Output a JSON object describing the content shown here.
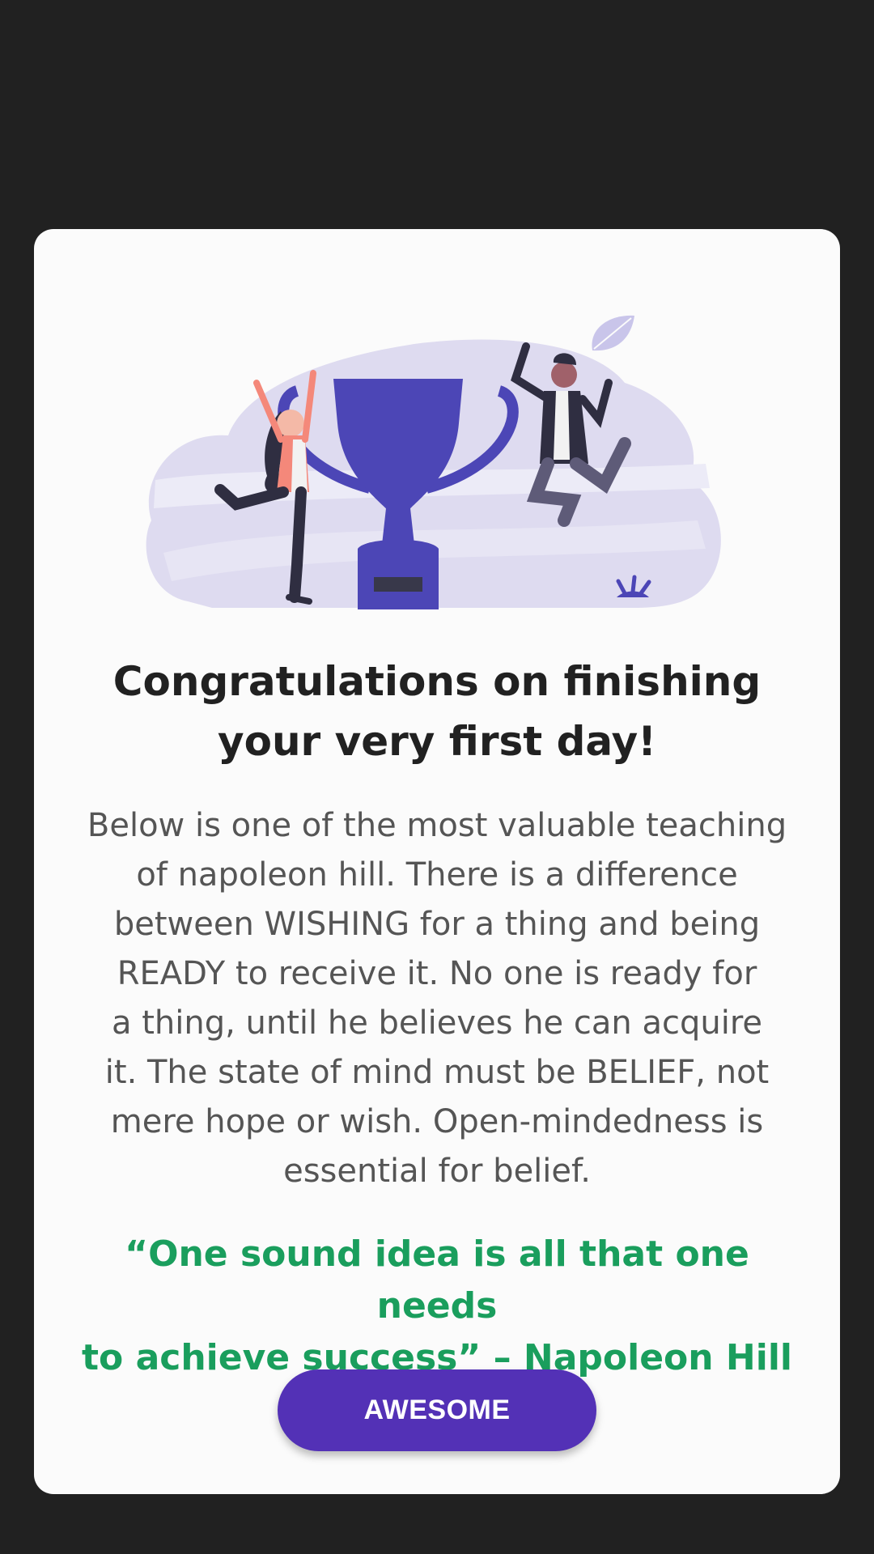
{
  "dialog": {
    "title": "Congratulations on finishing\nyour very first day!",
    "body": "Below is one of the most valuable teaching\nof napoleon hill.  There is a difference\nbetween WISHING for a thing and being\nREADY to receive it. No one is ready for\na thing, until he believes he can acquire\nit.  The state of mind must be BELIEF, not\nmere hope or wish. Open-mindedness is\nessential for belief.",
    "quote": "“One sound idea is all that one needs\nto achieve success” – Napoleon Hill",
    "button_label": "AWESOME"
  },
  "illustration": {
    "icon": "trophy-celebration-illustration"
  },
  "colors": {
    "background": "#212121",
    "dialog": "#fbfbfb",
    "accent": "#5331b6",
    "quote": "#1a9e5d",
    "title": "#212121",
    "body": "#555555"
  }
}
